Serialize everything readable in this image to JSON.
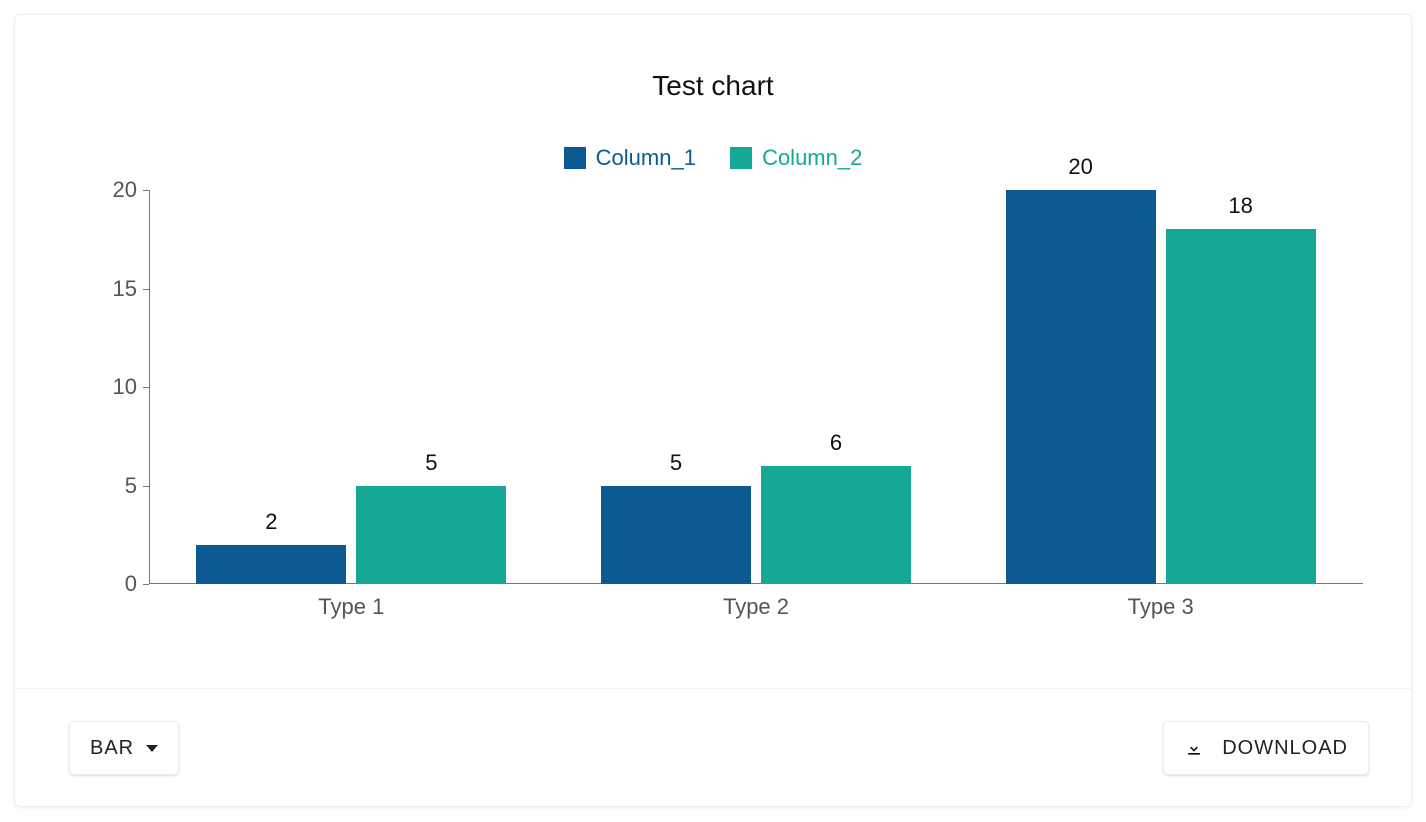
{
  "chart_data": {
    "type": "bar",
    "title": "Test chart",
    "categories": [
      "Type 1",
      "Type 2",
      "Type 3"
    ],
    "series": [
      {
        "name": "Column_1",
        "color": "#0c5a91",
        "values": [
          2,
          5,
          20
        ]
      },
      {
        "name": "Column_2",
        "color": "#17a796",
        "values": [
          5,
          6,
          18
        ]
      }
    ],
    "ylim": [
      0,
      20
    ],
    "yticks": [
      0,
      5,
      10,
      15,
      20
    ],
    "xlabel": "",
    "ylabel": ""
  },
  "toolbar": {
    "chart_type_label": "BAR",
    "download_label": "DOWNLOAD"
  }
}
